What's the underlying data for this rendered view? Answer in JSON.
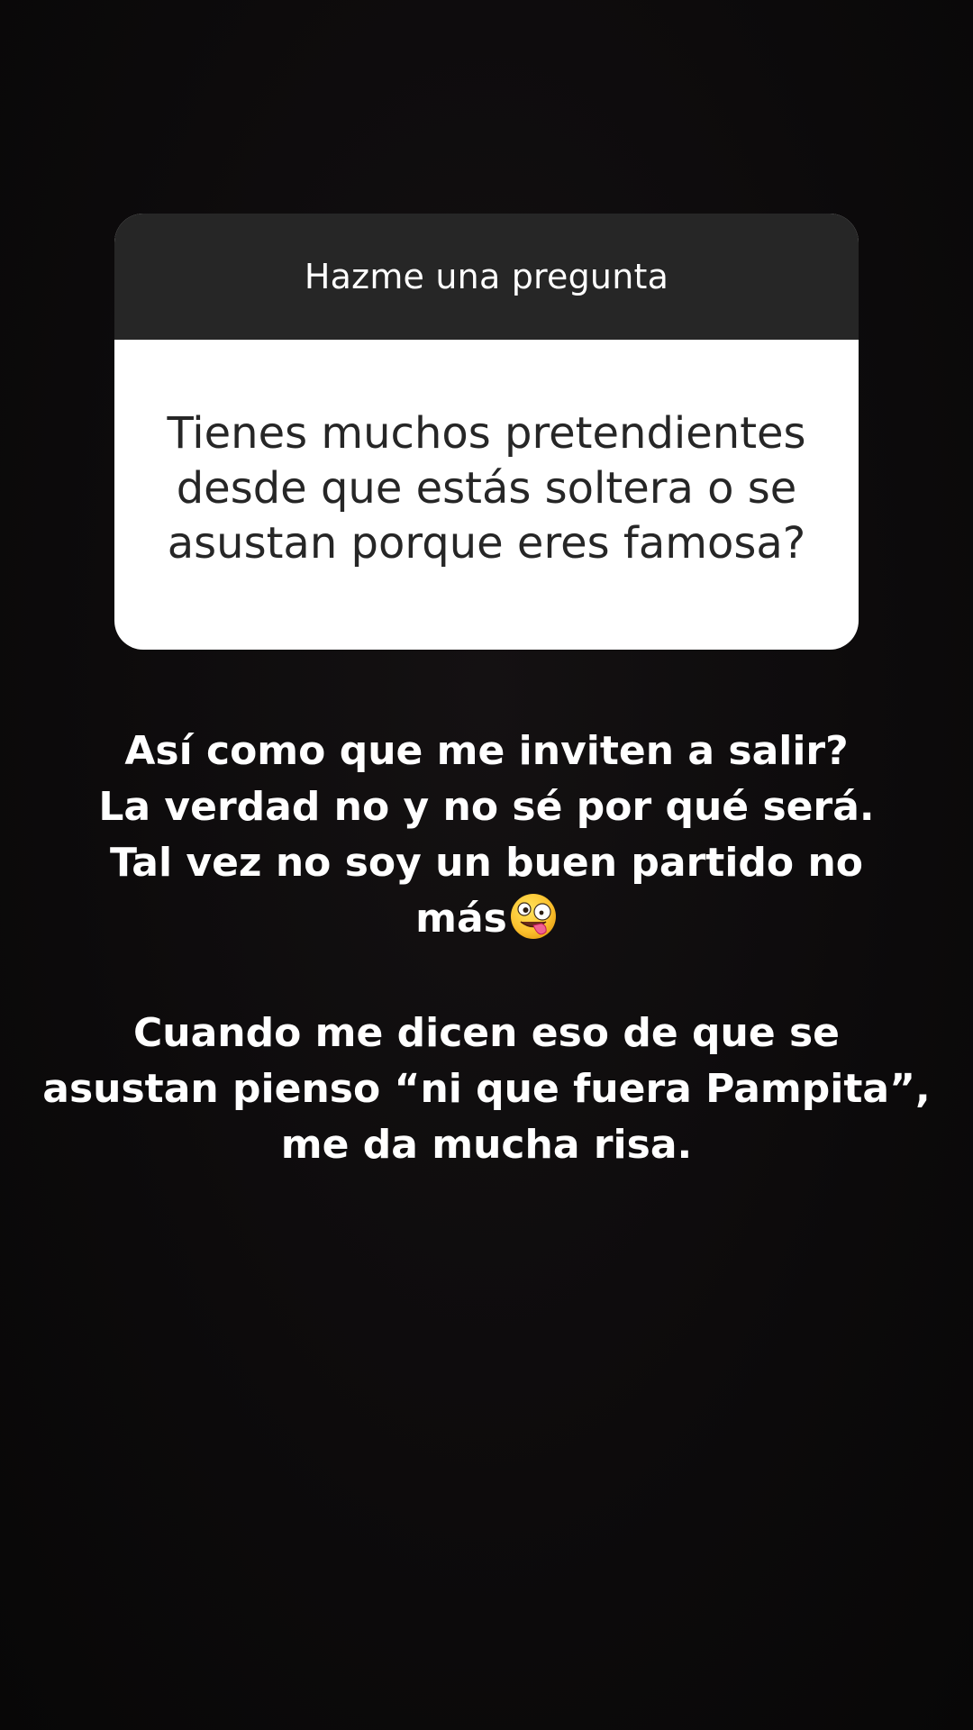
{
  "question_sticker": {
    "title": "Hazme una pregunta",
    "question_lines": [
      "Tienes muchos pretendientes",
      "desde que estás soltera o se",
      "asustan porque eres famosa?"
    ]
  },
  "answer": {
    "paragraph_1": {
      "lines": [
        "Así como que me inviten a salir?",
        "La verdad no y no sé por qué será.",
        "Tal vez no soy un buen partido no",
        "más"
      ],
      "emoji": "zany-face-emoji"
    },
    "paragraph_2": {
      "lines": [
        "Cuando me dicen eso de que se",
        "asustan pienso “ni que fuera Pampita”,",
        "me da mucha risa."
      ]
    }
  },
  "colors": {
    "background": "#0d0b0c",
    "card_header": "#262626",
    "card_body": "#ffffff",
    "question_text": "#262626",
    "answer_text": "#ffffff"
  }
}
